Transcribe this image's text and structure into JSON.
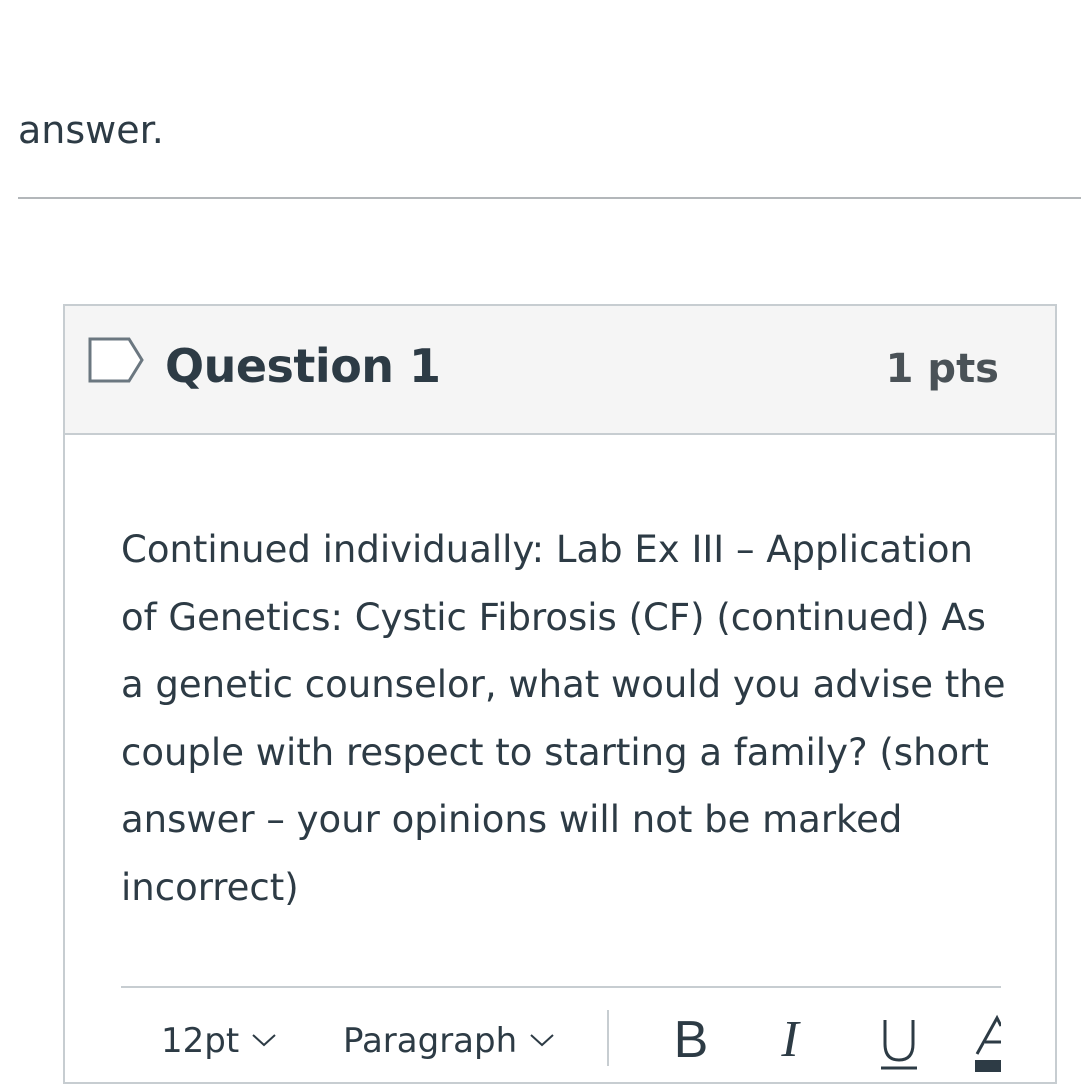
{
  "intro": {
    "tail_text": "answer."
  },
  "question": {
    "title": "Question 1",
    "points": "1 pts",
    "flag_icon": "flag-question-icon",
    "text": "Continued individually: Lab Ex III – Application of Genetics: Cystic Fibrosis (CF) (continued) As a genetic counselor, what would you advise the couple with respect to starting a family? (short answer – your opinions will not be marked incorrect)"
  },
  "editor": {
    "font_size_value": "12pt",
    "block_format_value": "Paragraph",
    "bold_label": "B",
    "italic_label": "I",
    "underline_label": "U",
    "font_color_label": "A",
    "icons": {
      "dropdown": "chevron-down-icon",
      "bold": "bold-icon",
      "italic": "italic-icon",
      "underline": "underline-icon",
      "font_color": "font-color-icon"
    }
  },
  "colors": {
    "text": "#2d3b45",
    "header_bg": "#f5f5f5",
    "border": "#c7cdd1",
    "divider": "#b3b7ba",
    "flag_stroke": "#6b7780"
  }
}
